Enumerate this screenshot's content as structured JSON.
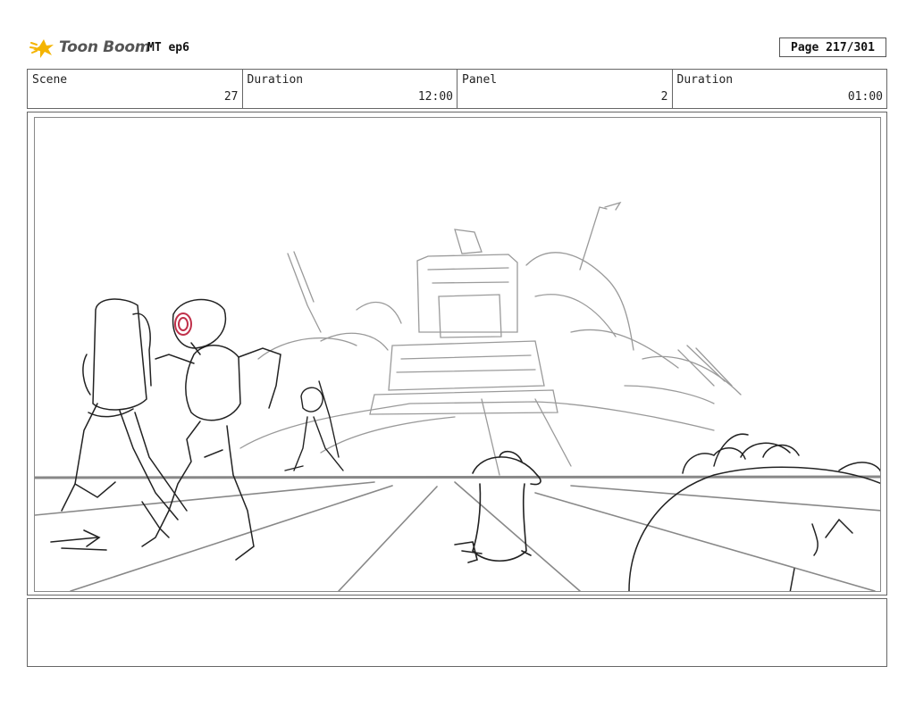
{
  "header": {
    "logo_text": "Toon Boom",
    "project": "MT ep6",
    "page": "Page 217/301"
  },
  "info": {
    "scene_label": "Scene",
    "scene_value": "27",
    "duration1_label": "Duration",
    "duration1_value": "12:00",
    "panel_label": "Panel",
    "panel_value": "2",
    "duration2_label": "Duration",
    "duration2_value": "01:00"
  },
  "panel": {
    "content": "storyboard-sketch"
  },
  "notes": {
    "text": ""
  },
  "colors": {
    "logo_accent": "#f4b400",
    "sketch_ink": "#222222",
    "sketch_background": "#9a9a9a",
    "robot_eye": "#c0304a"
  }
}
